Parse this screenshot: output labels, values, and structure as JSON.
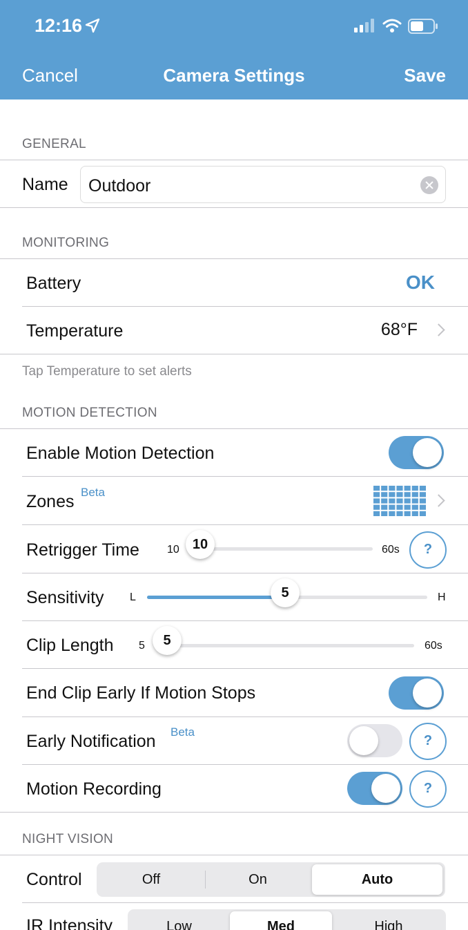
{
  "status_bar": {
    "time": "12:16"
  },
  "nav": {
    "cancel": "Cancel",
    "title": "Camera Settings",
    "save": "Save"
  },
  "general": {
    "header": "GENERAL",
    "name_label": "Name",
    "name_value": "Outdoor"
  },
  "monitoring": {
    "header": "MONITORING",
    "battery_label": "Battery",
    "battery_value": "OK",
    "temperature_label": "Temperature",
    "temperature_value": "68°F",
    "footnote": "Tap Temperature to set alerts"
  },
  "motion": {
    "header": "MOTION DETECTION",
    "enable_label": "Enable Motion Detection",
    "enable_on": true,
    "zones_label": "Zones",
    "zones_badge": "Beta",
    "retrigger_label": "Retrigger Time",
    "retrigger_min": "10",
    "retrigger_max": "60s",
    "retrigger_value": "10",
    "sensitivity_label": "Sensitivity",
    "sensitivity_min": "L",
    "sensitivity_max": "H",
    "sensitivity_value": "5",
    "clip_label": "Clip Length",
    "clip_min": "5",
    "clip_max": "60s",
    "clip_value": "5",
    "end_clip_label": "End Clip Early If Motion Stops",
    "end_clip_on": true,
    "early_notif_label": "Early Notification",
    "early_notif_badge": "Beta",
    "early_notif_on": false,
    "recording_label": "Motion Recording",
    "recording_on": true,
    "help_glyph": "?"
  },
  "night_vision": {
    "header": "NIGHT VISION",
    "control_label": "Control",
    "control_options": [
      "Off",
      "On",
      "Auto"
    ],
    "control_selected": "Auto",
    "ir_label": "IR Intensity",
    "ir_options": [
      "Low",
      "Med",
      "High"
    ],
    "ir_selected": "Med"
  },
  "colors": {
    "accent": "#5b9fd3",
    "link": "#4a90c8"
  }
}
